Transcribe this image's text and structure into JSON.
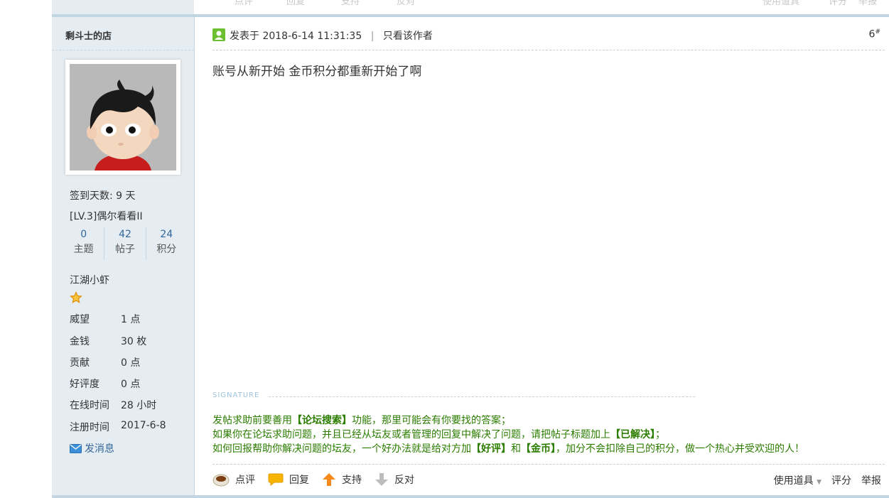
{
  "prev_post_footer": {
    "actions": [
      "点评",
      "回复",
      "支持",
      "反对"
    ],
    "right": [
      "使用道具",
      "评分",
      "举报"
    ]
  },
  "sidebar": {
    "author": "剩斗士的店",
    "checkin": "签到天数: 9 天",
    "level": "[LV.3]偶尔看看II",
    "stats": [
      {
        "num": "0",
        "label": "主题"
      },
      {
        "num": "42",
        "label": "帖子"
      },
      {
        "num": "24",
        "label": "积分"
      }
    ],
    "rank": "江湖小虾",
    "info": [
      {
        "k": "威望",
        "v": "1 点"
      },
      {
        "k": "金钱",
        "v": "30 枚"
      },
      {
        "k": "贡献",
        "v": "0 点"
      },
      {
        "k": "好评度",
        "v": "0 点"
      },
      {
        "k": "在线时间",
        "v": "28 小时"
      },
      {
        "k": "注册时间",
        "v": "2017-6-8"
      }
    ],
    "send_message": "发消息"
  },
  "post": {
    "posted_at": "发表于 2018-6-14 11:31:35",
    "separator": "|",
    "only_author": "只看该作者",
    "floor": "6",
    "floor_sup": "#",
    "content": "账号从新开始 金币积分都重新开始了啊"
  },
  "signature": {
    "label": "SIGNATURE",
    "line1_a": "发帖求助前要善用",
    "line1_b": "【论坛搜索】",
    "line1_c": "功能，那里可能会有你要找的答案；",
    "line2_a": "如果你在论坛求助问题，并且已经从坛友或者管理的回复中解决了问题，请把帖子标题加上",
    "line2_b": "【已解决】",
    "line2_c": "；",
    "line3_a": "如何回报帮助你解决问题的坛友，一个好办法就是给对方加",
    "line3_b": "【好评】",
    "line3_c": "和",
    "line3_d": "【金币】",
    "line3_e": "，加分不会扣除自己的积分，做一个热心并受欢迎的人！"
  },
  "actions": {
    "comment": "点评",
    "reply": "回复",
    "support": "支持",
    "oppose": "反对",
    "use_tool": "使用道具",
    "rate": "评分",
    "report": "举报"
  }
}
